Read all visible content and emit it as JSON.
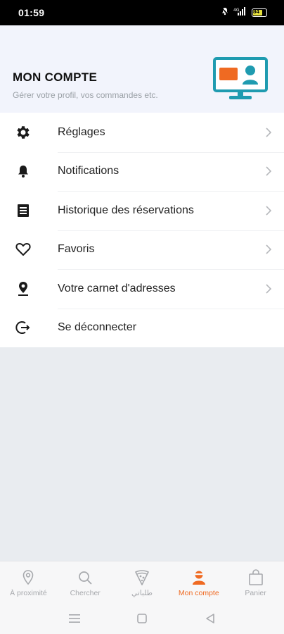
{
  "status_bar": {
    "time": "01:59",
    "battery_level": "84",
    "icons": [
      "bell-mute-icon",
      "signal-icon",
      "battery-icon"
    ]
  },
  "header": {
    "title": "MON COMPTE",
    "subtitle": "Gérer votre profil, vos commandes etc."
  },
  "menu": {
    "items": [
      {
        "label": "Réglages",
        "icon": "gear-icon",
        "chevron": true
      },
      {
        "label": "Notifications",
        "icon": "bell-icon",
        "chevron": true
      },
      {
        "label": "Historique des réservations",
        "icon": "list-icon",
        "chevron": true
      },
      {
        "label": "Favoris",
        "icon": "heart-icon",
        "chevron": true
      },
      {
        "label": "Votre carnet d'adresses",
        "icon": "location-pin-icon",
        "chevron": true
      },
      {
        "label": "Se déconnecter",
        "icon": "logout-icon",
        "chevron": false
      }
    ]
  },
  "bottom_nav": {
    "tabs": [
      {
        "label": "À proximité",
        "icon": "map-pin-icon",
        "active": false
      },
      {
        "label": "Chercher",
        "icon": "search-icon",
        "active": false
      },
      {
        "label": "طلباتي",
        "icon": "pizza-icon",
        "active": false
      },
      {
        "label": "Mon compte",
        "icon": "user-icon",
        "active": true
      },
      {
        "label": "Panier",
        "icon": "shopping-bag-icon",
        "active": false
      }
    ]
  },
  "colors": {
    "accent": "#ef6a22",
    "header_bg": "#f2f4fc",
    "illustration_teal": "#1f9bb0"
  }
}
